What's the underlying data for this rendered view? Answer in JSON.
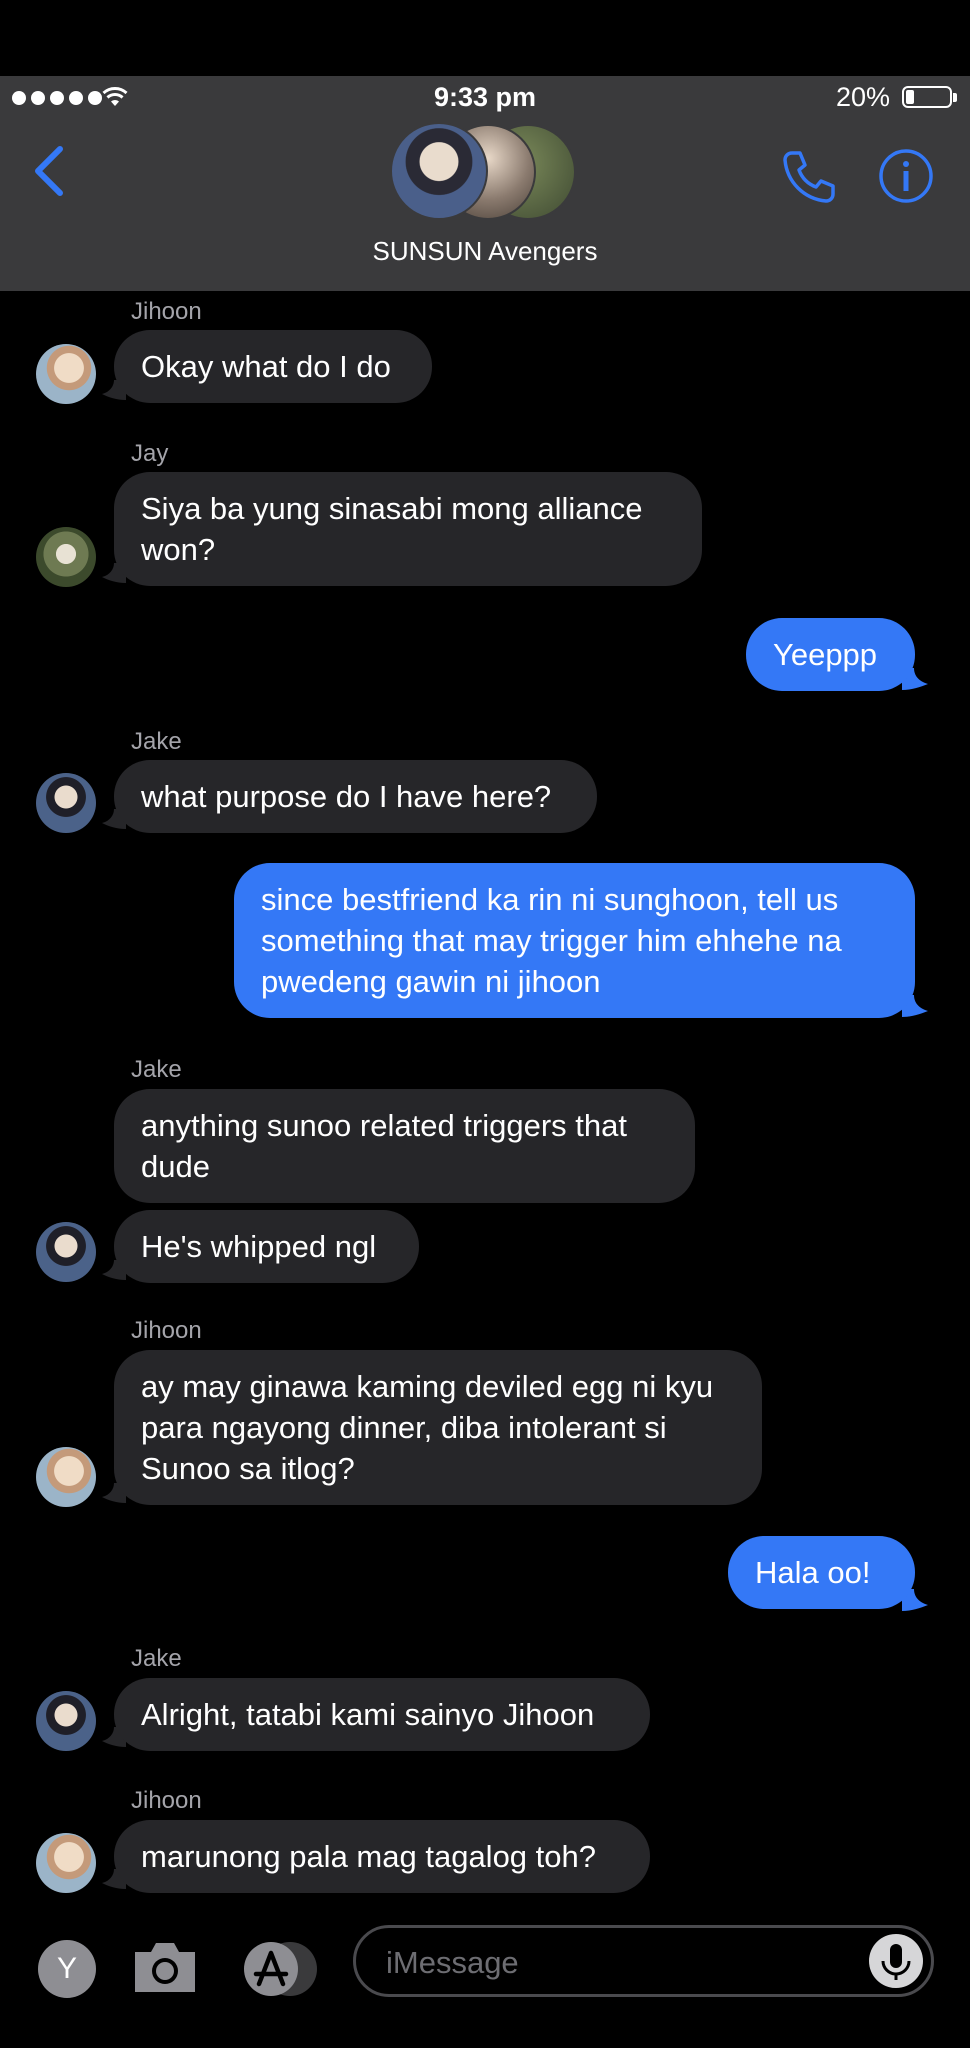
{
  "status_bar": {
    "time": "9:33 pm",
    "battery_percent": "20%",
    "battery_level": 0.2
  },
  "header": {
    "group_name": "SUNSUN Avengers",
    "icons": [
      "back-chevron-icon",
      "phone-icon",
      "info-icon"
    ]
  },
  "messages": [
    {
      "sender": "Jihoon",
      "text": "Okay what do I do",
      "direction": "incoming"
    },
    {
      "sender": "Jay",
      "text": "Siya ba yung sinasabi mong alliance won?",
      "direction": "incoming"
    },
    {
      "text": "Yeeppp",
      "direction": "outgoing"
    },
    {
      "sender": "Jake",
      "text": "what purpose do I have here?",
      "direction": "incoming"
    },
    {
      "text": "since bestfriend ka rin ni sunghoon, tell us something that may trigger him ehhehe na pwedeng gawin ni jihoon",
      "direction": "outgoing"
    },
    {
      "sender": "Jake",
      "text": "anything sunoo related triggers that dude",
      "direction": "incoming"
    },
    {
      "text": "He's whipped ngl",
      "direction": "incoming"
    },
    {
      "sender": "Jihoon",
      "text": "ay may ginawa kaming deviled egg ni kyu para ngayong dinner, diba intolerant si Sunoo sa itlog?",
      "direction": "incoming"
    },
    {
      "text": "Hala oo!",
      "direction": "outgoing"
    },
    {
      "sender": "Jake",
      "text": "Alright, tatabi kami sainyo Jihoon",
      "direction": "incoming"
    },
    {
      "sender": "Jihoon",
      "text": "marunong pala mag tagalog toh?",
      "direction": "incoming"
    }
  ],
  "input": {
    "avatar_letter": "Y",
    "placeholder": "iMessage"
  },
  "colors": {
    "header_bg": "#3a3a3c",
    "incoming_bubble": "#262629",
    "outgoing_bubble": "#3478f6",
    "accent": "#3478f6"
  }
}
